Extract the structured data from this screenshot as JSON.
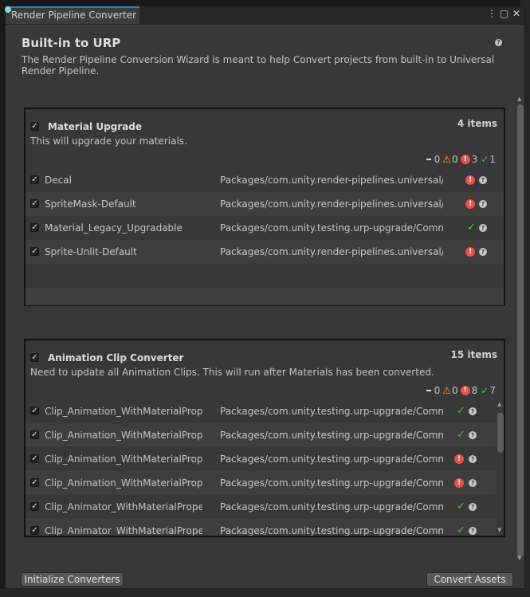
{
  "window": {
    "tab_title": "Render Pipeline Converter",
    "menu_icon": "kebab-menu-icon",
    "maximize_icon": "maximize-icon",
    "close_icon": "close-icon"
  },
  "header": {
    "title": "Built-in to URP",
    "description": "The Render Pipeline Conversion Wizard is meant to help Convert projects from built-in to Universal Render Pipeline."
  },
  "panels": [
    {
      "title": "Material Upgrade",
      "count": "4 items",
      "description": "This will upgrade your materials.",
      "stats": {
        "pending": "0",
        "warnings": "0",
        "errors": "3",
        "success": "1"
      },
      "rows": [
        {
          "name": "Decal",
          "path": "Packages/com.unity.render-pipelines.universal/Runtime",
          "status": "error"
        },
        {
          "name": "SpriteMask-Default",
          "path": "Packages/com.unity.render-pipelines.universal/Runtime",
          "status": "error"
        },
        {
          "name": "Material_Legacy_Upgradable",
          "path": "Packages/com.unity.testing.urp-upgrade/Common",
          "status": "success"
        },
        {
          "name": "Sprite-Unlit-Default",
          "path": "Packages/com.unity.render-pipelines.universal/Runtime",
          "status": "error"
        }
      ]
    },
    {
      "title": "Animation Clip Converter",
      "count": "15 items",
      "description": "Need to update all Animation Clips. This will run after Materials has been converted.",
      "stats": {
        "pending": "0",
        "warnings": "0",
        "errors": "8",
        "success": "7"
      },
      "rows": [
        {
          "name": "Clip_Animation_WithMaterialProperties",
          "path": "Packages/com.unity.testing.urp-upgrade/Common",
          "status": "success"
        },
        {
          "name": "Clip_Animation_WithMaterialProperties",
          "path": "Packages/com.unity.testing.urp-upgrade/Common",
          "status": "success"
        },
        {
          "name": "Clip_Animation_WithMaterialProperties",
          "path": "Packages/com.unity.testing.urp-upgrade/Common",
          "status": "error"
        },
        {
          "name": "Clip_Animation_WithMaterialProperties",
          "path": "Packages/com.unity.testing.urp-upgrade/Common",
          "status": "error"
        },
        {
          "name": "Clip_Animator_WithMaterialProperties",
          "path": "Packages/com.unity.testing.urp-upgrade/Common",
          "status": "success"
        },
        {
          "name": "Clip_Animator_WithMaterialProperties",
          "path": "Packages/com.unity.testing.urp-upgrade/Common",
          "status": "success"
        }
      ]
    }
  ],
  "footer": {
    "initialize_label": "Initialize Converters",
    "convert_label": "Convert Assets"
  },
  "colors": {
    "accent": "#3a79bb",
    "error": "#e85151",
    "warning": "#f2b517",
    "success": "#53c44e"
  }
}
